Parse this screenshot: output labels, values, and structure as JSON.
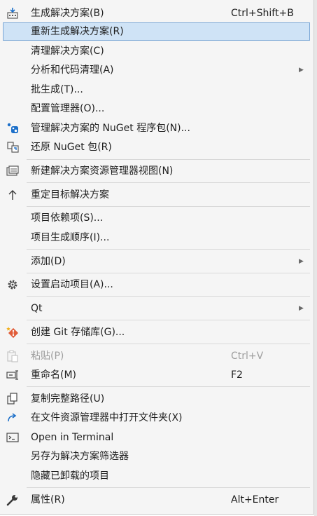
{
  "menu": {
    "items": [
      {
        "label": "生成解决方案(B)",
        "shortcut": "Ctrl+Shift+B",
        "icon": "build-icon"
      },
      {
        "label": "重新生成解决方案(R)"
      },
      {
        "label": "清理解决方案(C)"
      },
      {
        "label": "分析和代码清理(A)"
      },
      {
        "label": "批生成(T)..."
      },
      {
        "label": "配置管理器(O)..."
      },
      {
        "label": "管理解决方案的 NuGet 程序包(N)...",
        "icon": "nuget-icon"
      },
      {
        "label": "还原 NuGet 包(R)",
        "icon": "restore-packages-icon"
      },
      {
        "label": "新建解决方案资源管理器视图(N)",
        "icon": "new-view-icon"
      },
      {
        "label": "重定目标解决方案",
        "icon": "up-arrow-icon"
      },
      {
        "label": "项目依赖项(S)..."
      },
      {
        "label": "项目生成顺序(I)..."
      },
      {
        "label": "添加(D)"
      },
      {
        "label": "设置启动项目(A)...",
        "icon": "gear-icon"
      },
      {
        "label": "Qt"
      },
      {
        "label": "创建 Git 存储库(G)...",
        "icon": "git-icon"
      },
      {
        "label": "粘贴(P)",
        "shortcut": "Ctrl+V",
        "icon": "paste-icon"
      },
      {
        "label": "重命名(M)",
        "shortcut": "F2",
        "icon": "rename-icon"
      },
      {
        "label": "复制完整路径(U)",
        "icon": "copy-icon"
      },
      {
        "label": "在文件资源管理器中打开文件夹(X)",
        "icon": "open-folder-arrow-icon"
      },
      {
        "label": "Open in Terminal",
        "icon": "terminal-icon"
      },
      {
        "label": "另存为解决方案筛选器"
      },
      {
        "label": "隐藏已卸载的项目"
      },
      {
        "label": "属性(R)",
        "shortcut": "Alt+Enter",
        "icon": "wrench-icon"
      }
    ],
    "submenu_arrow": "▶"
  },
  "colors": {
    "highlight_bg": "#cfe3f6",
    "highlight_border": "#7aa7d6",
    "disabled_text": "#9e9e9e",
    "accent_blue": "#1c6fc9"
  }
}
